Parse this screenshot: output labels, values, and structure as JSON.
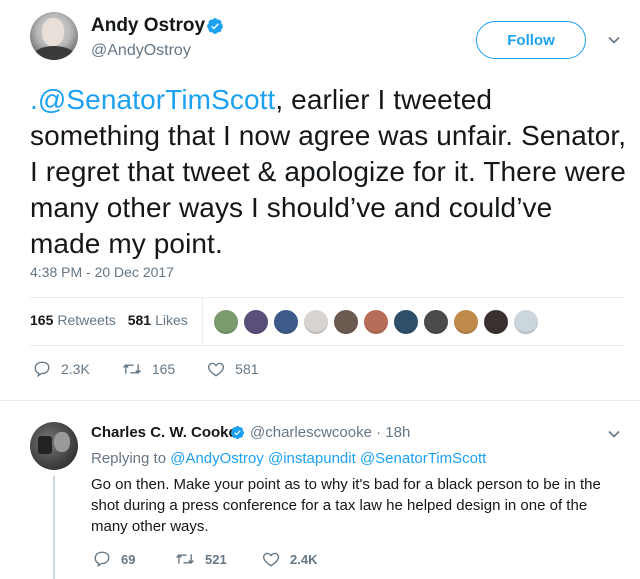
{
  "tweet": {
    "author_name": "Andy Ostroy",
    "author_handle": "@AndyOstroy",
    "follow_label": "Follow",
    "text_mention": ".@SenatorTimScott",
    "text_rest": ", earlier I tweeted something that I now agree was unfair. Senator, I regret that tweet & apologize for it. There were many other ways I should’ve and could’ve made my point.",
    "timestamp": "4:38 PM - 20 Dec 2017",
    "retweets_count": "165",
    "retweets_label": "Retweets",
    "likes_count": "581",
    "likes_label": "Likes",
    "actions": {
      "replies": "2.3K",
      "retweets": "165",
      "likes": "581"
    }
  },
  "likers": [
    {
      "color": "#7a9b6e"
    },
    {
      "color": "#5a4f7a"
    },
    {
      "color": "#3c5a8a"
    },
    {
      "color": "#d9d4d0"
    },
    {
      "color": "#6a5a50"
    },
    {
      "color": "#b86c5a"
    },
    {
      "color": "#2d4f6a"
    },
    {
      "color": "#4a4a4a"
    },
    {
      "color": "#c08a4a"
    },
    {
      "color": "#3a3030"
    },
    {
      "color": "#ccd6dd"
    }
  ],
  "reply": {
    "author_name": "Charles C. W. Cooke",
    "author_handle": "@charlescwcooke",
    "time": "18h",
    "replying_prefix": "Replying to",
    "replying_to": [
      "@AndyOstroy",
      "@instapundit",
      "@SenatorTimScott"
    ],
    "text": "Go on then. Make your point as to why it's bad for a black person to be in the shot during a press conference for a tax law he helped design in one of the many other ways.",
    "actions": {
      "replies": "69",
      "retweets": "521",
      "likes": "2.4K"
    }
  },
  "colors": {
    "accent": "#1da1f2",
    "muted": "#657786",
    "text": "#14171a",
    "border": "#e6ecf0"
  }
}
